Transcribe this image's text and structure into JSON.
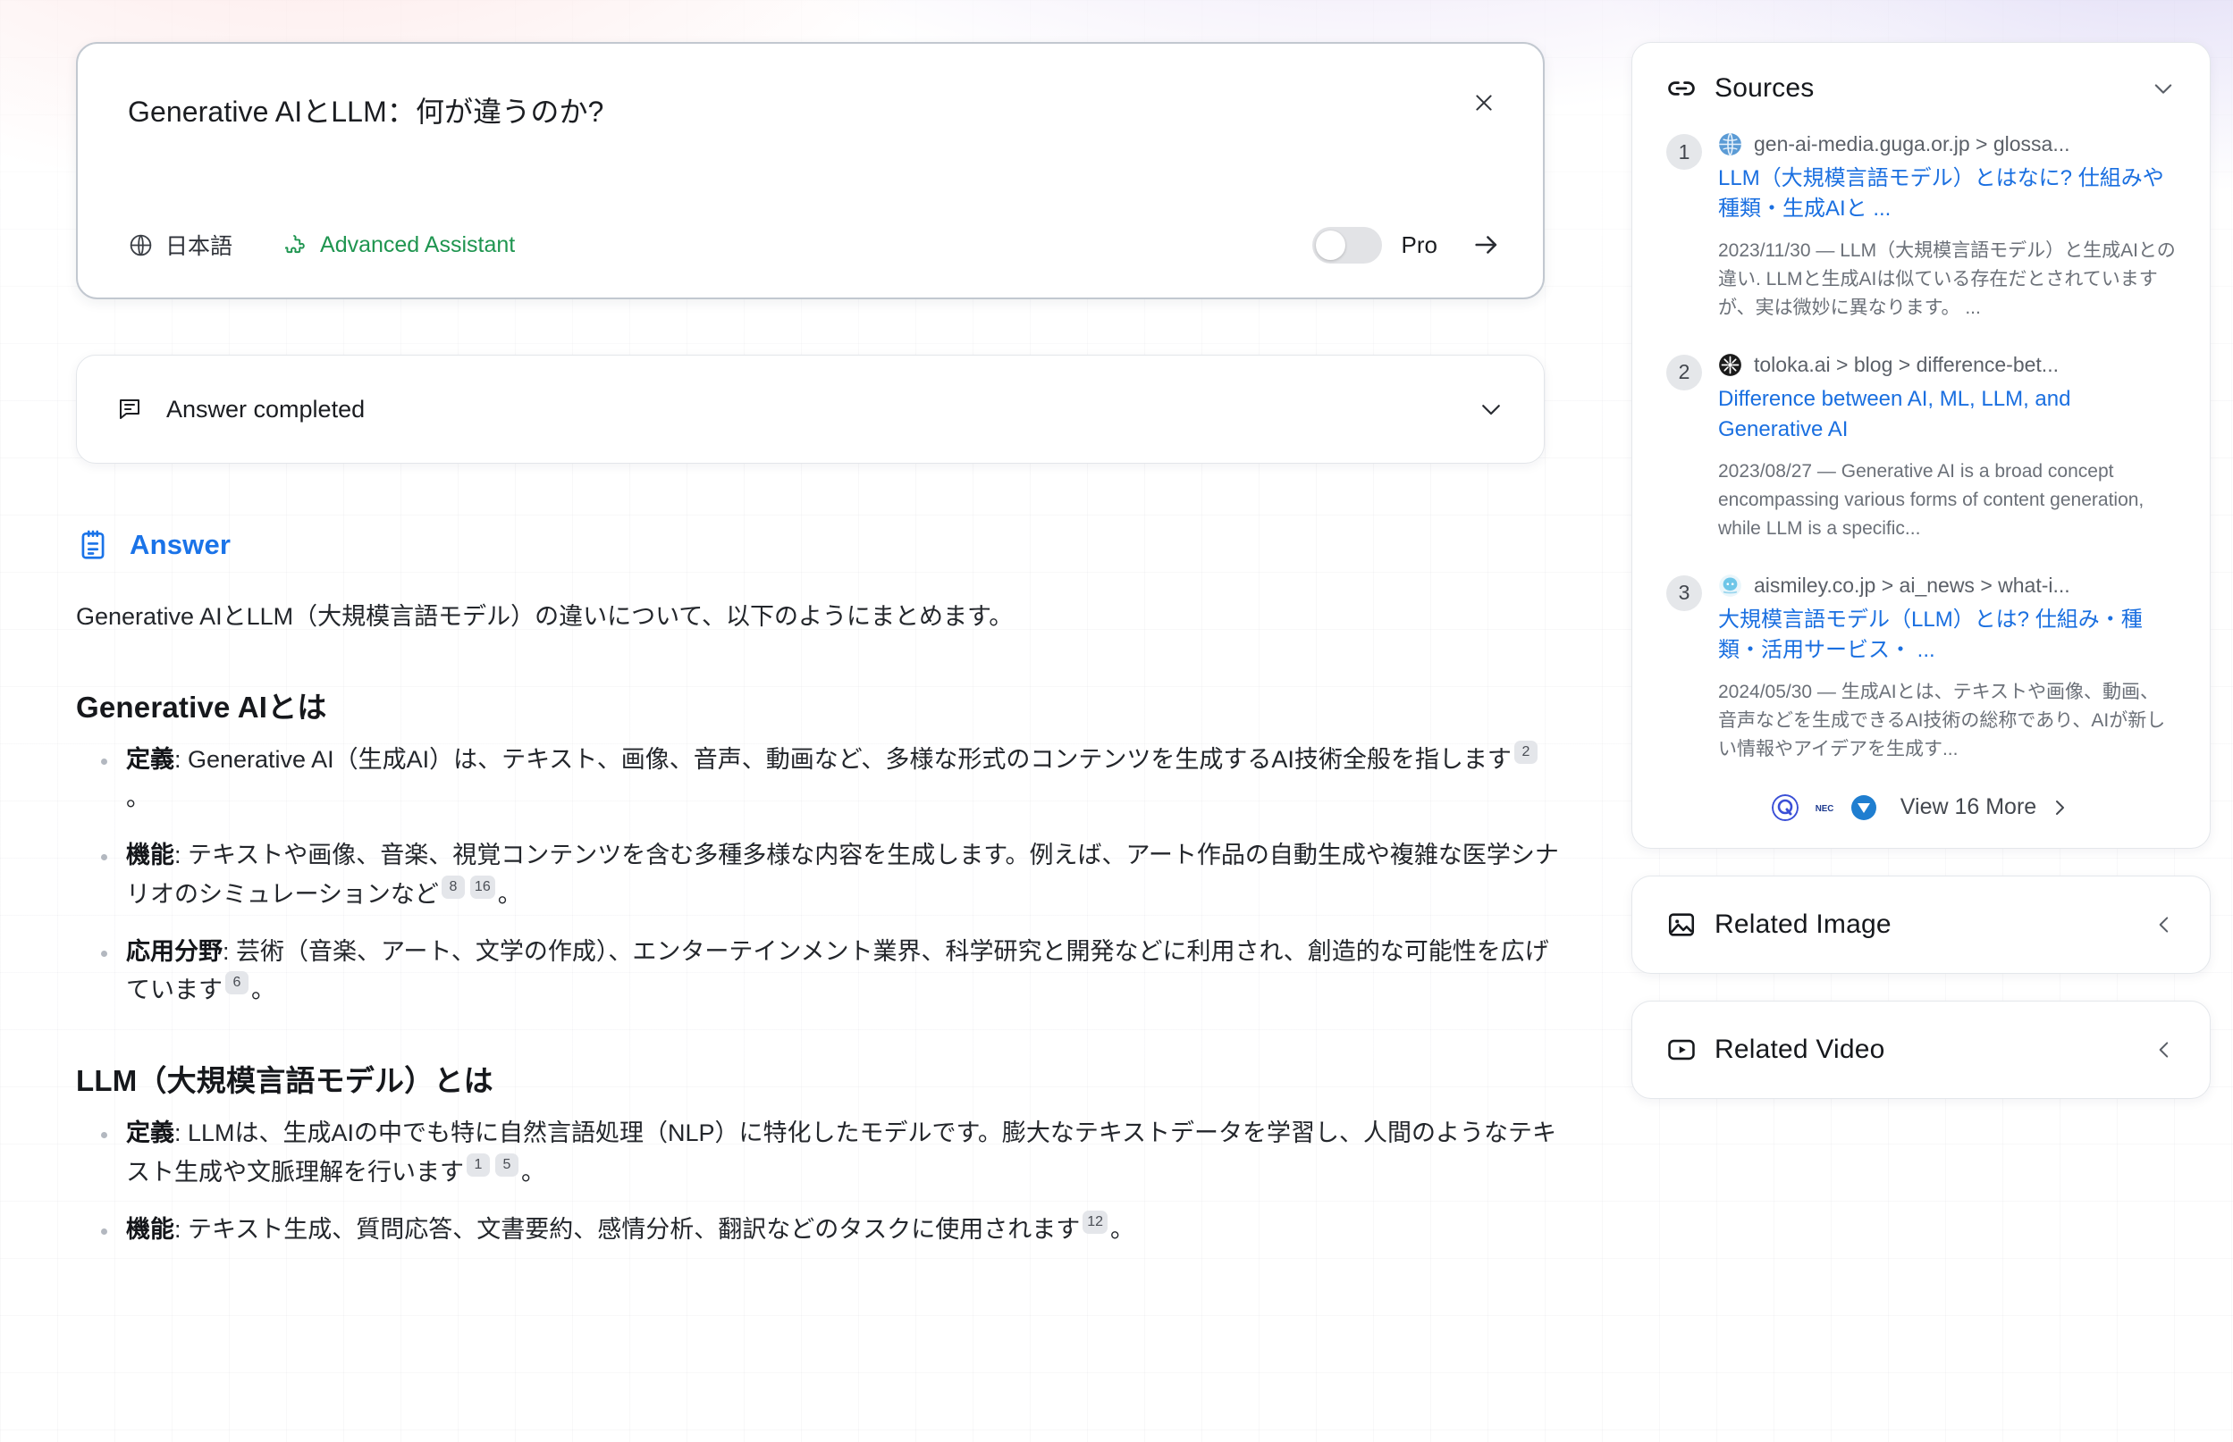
{
  "query": {
    "text": "Generative AIとLLM：何が違うのか?",
    "close_icon": "close-icon",
    "language_label": "日本語",
    "language_icon": "globe-icon",
    "assistant_label": "Advanced Assistant",
    "assistant_icon": "puzzle-piece-icon",
    "pro_label": "Pro",
    "pro_enabled": false,
    "submit_icon": "arrow-right-icon"
  },
  "status": {
    "icon": "chat-bubble-icon",
    "text": "Answer completed",
    "chevron_icon": "chevron-down-icon"
  },
  "answer": {
    "icon": "notepad-icon",
    "title": "Answer",
    "intro": "Generative AIとLLM（大規模言語モデル）の違いについて、以下のようにまとめます。",
    "sections": [
      {
        "heading": "Generative AIとは",
        "bullets": [
          {
            "term": "定義",
            "text": "Generative AI（生成AI）は、テキスト、画像、音声、動画など、多様な形式のコンテンツを生成するAI技術全般を指します",
            "citations": [
              "2"
            ],
            "tail": "。"
          },
          {
            "term": "機能",
            "text": "テキストや画像、音楽、視覚コンテンツを含む多種多様な内容を生成します。例えば、アート作品の自動生成や複雑な医学シナリオのシミュレーションなど",
            "citations": [
              "8",
              "16"
            ],
            "tail": "。"
          },
          {
            "term": "応用分野",
            "text": "芸術（音楽、アート、文学の作成）、エンターテインメント業界、科学研究と開発などに利用され、創造的な可能性を広げています",
            "citations": [
              "6"
            ],
            "tail": "。"
          }
        ]
      },
      {
        "heading": "LLM（大規模言語モデル）とは",
        "bullets": [
          {
            "term": "定義",
            "text": "LLMは、生成AIの中でも特に自然言語処理（NLP）に特化したモデルです。膨大なテキストデータを学習し、人間のようなテキスト生成や文脈理解を行います",
            "citations": [
              "1",
              "5"
            ],
            "tail": "。"
          },
          {
            "term": "機能",
            "text": "テキスト生成、質問応答、文書要約、感情分析、翻訳などのタスクに使用されます",
            "citations": [
              "12"
            ],
            "tail": "。"
          }
        ]
      }
    ]
  },
  "sources_panel": {
    "icon": "link-icon",
    "title": "Sources",
    "chevron_icon": "chevron-down-icon",
    "items": [
      {
        "index": "1",
        "url": "gen-ai-media.guga.or.jp > glossa...",
        "favicon": "globe-favicon",
        "favicon_color": "#5b9bd5",
        "title": "LLM（大規模言語モデル）とはなに? 仕組みや種類・生成AIと ...",
        "snippet": "2023/11/30 — LLM（大規模言語モデル）と生成AIとの違い. LLMと生成AIは似ている存在だとされていますが、実は微妙に異なります。 ..."
      },
      {
        "index": "2",
        "url": "toloka.ai > blog > difference-bet...",
        "favicon": "toloka-favicon",
        "favicon_color": "#1b1b1b",
        "title": "Difference between AI, ML, LLM, and Generative AI",
        "snippet": "2023/08/27 — Generative AI is a broad concept encompassing various forms of content generation, while LLM is a specific..."
      },
      {
        "index": "3",
        "url": "aismiley.co.jp > ai_news > what-i...",
        "favicon": "aismiley-favicon",
        "favicon_color": "#6ec6e8",
        "title": "大規模言語モデル（LLM）とは? 仕組み・種類・活用サービス・ ...",
        "snippet": "2024/05/30 — 生成AIとは、テキストや画像、動画、音声などを生成できるAI技術の総称であり、AIが新しい情報やアイデアを生成す..."
      }
    ],
    "view_more_label": "View 16 More",
    "view_more_chevron": "chevron-right-icon",
    "view_more_favicons": [
      {
        "name": "qiita-favicon",
        "color": "#3a4fd6"
      },
      {
        "name": "nec-favicon",
        "color": "#1d3a8f"
      },
      {
        "name": "zenn-favicon",
        "color": "#1f7ed0"
      }
    ]
  },
  "related_image": {
    "icon": "image-icon",
    "title": "Related Image",
    "chevron_icon": "chevron-left-icon"
  },
  "related_video": {
    "icon": "video-icon",
    "title": "Related Video",
    "chevron_icon": "chevron-left-icon"
  },
  "theme": {
    "accent_blue": "#1a73e8",
    "link_blue": "#1a6fe0",
    "assistant_green": "#1f9550"
  }
}
